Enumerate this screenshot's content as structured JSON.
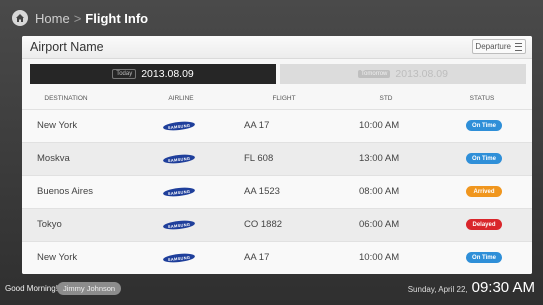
{
  "header": {
    "home_label": "Home",
    "separator": ">",
    "current": "Flight Info"
  },
  "panel": {
    "title": "Airport Name",
    "mode_button": "Departure"
  },
  "tabs": {
    "today_badge": "Today",
    "today_date": "2013.08.09",
    "tomorrow_badge": "Tomorrow",
    "tomorrow_date": "2013.08.09"
  },
  "columns": {
    "destination": "DESTINATION",
    "airline": "AIRLINE",
    "flight": "FLIGHT",
    "std": "STD",
    "status": "STATUS"
  },
  "flights": [
    {
      "destination": "New York",
      "airline": "SAMSUNG",
      "flight": "AA 17",
      "std": "10:00 AM",
      "status": "On Time",
      "status_color": "#2f8fd8"
    },
    {
      "destination": "Moskva",
      "airline": "SAMSUNG",
      "flight": "FL 608",
      "std": "13:00 AM",
      "status": "On Time",
      "status_color": "#2f8fd8"
    },
    {
      "destination": "Buenos Aires",
      "airline": "SAMSUNG",
      "flight": "AA 1523",
      "std": "08:00 AM",
      "status": "Arrived",
      "status_color": "#f0961e"
    },
    {
      "destination": "Tokyo",
      "airline": "SAMSUNG",
      "flight": "CO 1882",
      "std": "06:00 AM",
      "status": "Delayed",
      "status_color": "#d9262b"
    },
    {
      "destination": "New York",
      "airline": "SAMSUNG",
      "flight": "AA 17",
      "std": "10:00 AM",
      "status": "On Time",
      "status_color": "#2f8fd8"
    }
  ],
  "footer": {
    "greeting": "Good Morning!",
    "user": "Jimmy Johnson",
    "date": "Sunday, April 22,",
    "time": "09:30 AM"
  },
  "icons": {
    "home": "home-icon",
    "menu": "menu-icon"
  }
}
